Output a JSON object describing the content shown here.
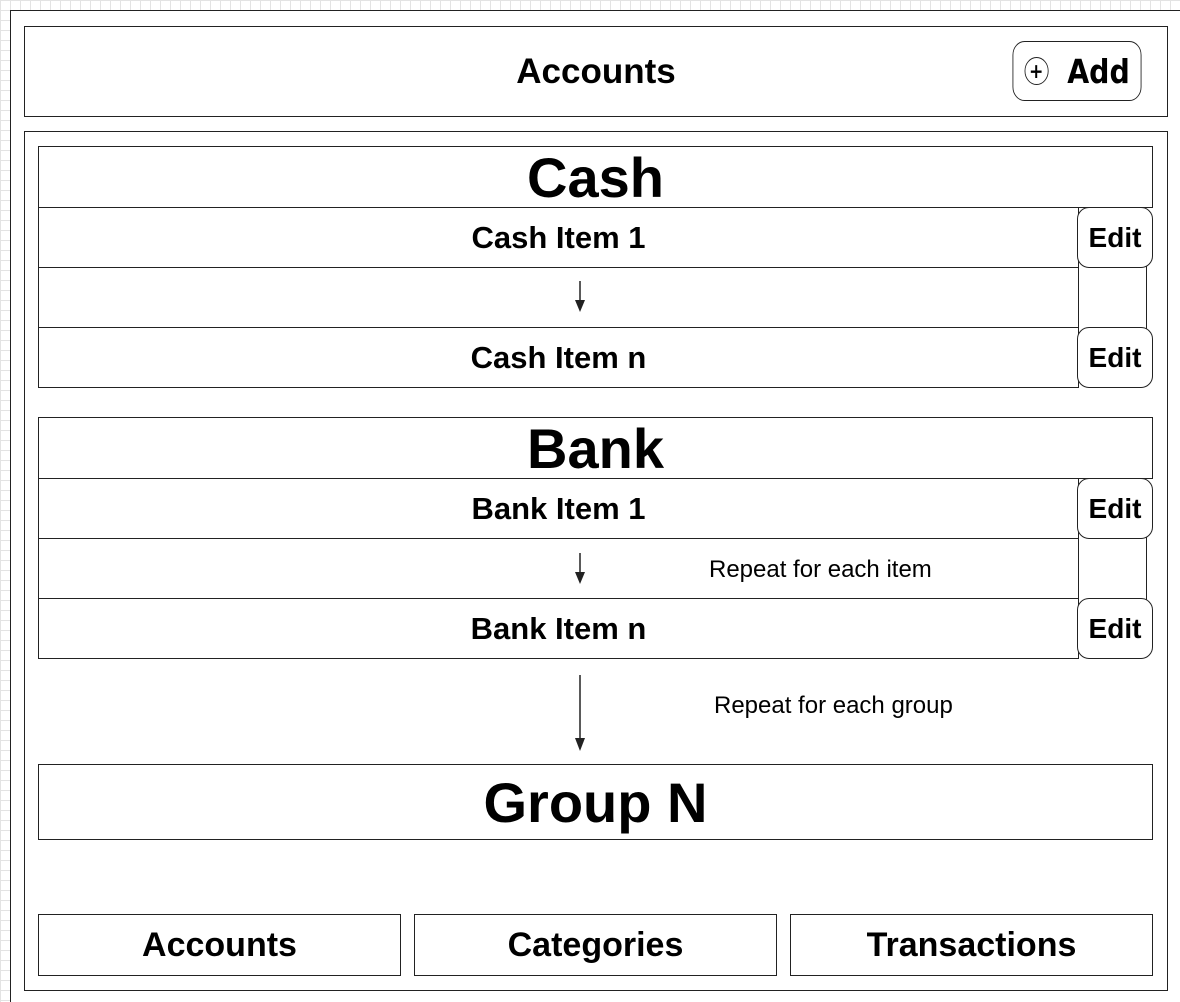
{
  "header": {
    "title": "Accounts",
    "add_label": "Add",
    "add_icon": "plus-circle-icon",
    "add_icon_glyph": "+"
  },
  "groups": [
    {
      "title": "Cash",
      "first_item": "Cash Item 1",
      "last_item": "Cash Item n",
      "edit_label": "Edit"
    },
    {
      "title": "Bank",
      "first_item": "Bank Item 1",
      "last_item": "Bank Item n",
      "edit_label": "Edit",
      "repeat_note": "Repeat for each item"
    }
  ],
  "group_repeat_note": "Repeat for each group",
  "last_group": {
    "title": "Group N"
  },
  "tabs": [
    {
      "label": "Accounts"
    },
    {
      "label": "Categories"
    },
    {
      "label": "Transactions"
    }
  ]
}
